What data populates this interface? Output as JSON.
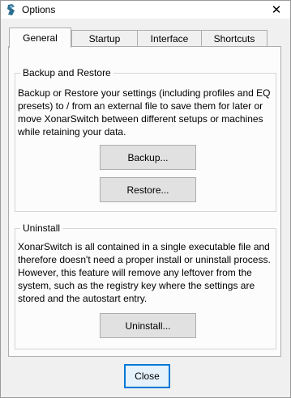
{
  "window": {
    "title": "Options",
    "close_glyph": "✕"
  },
  "tabs": [
    {
      "label": "General",
      "active": true
    },
    {
      "label": "Startup",
      "active": false
    },
    {
      "label": "Interface",
      "active": false
    },
    {
      "label": "Shortcuts",
      "active": false
    }
  ],
  "backup_group": {
    "legend": "Backup and Restore",
    "text": "Backup or Restore your settings (including profiles and EQ presets) to / from an external file to save them for later or move XonarSwitch between different setups or machines while retaining your data.",
    "backup_label": "Backup...",
    "restore_label": "Restore..."
  },
  "uninstall_group": {
    "legend": "Uninstall",
    "text": "XonarSwitch is all contained in a single executable file and therefore doesn't need a proper install or uninstall process. However, this feature will remove any leftover from the system, such as the registry key where the settings are stored and the autostart entry.",
    "uninstall_label": "Uninstall..."
  },
  "footer": {
    "close_label": "Close"
  },
  "colors": {
    "accent": "#0078d7",
    "panel_bg": "#fcfcfc",
    "window_bg": "#f0f0f0"
  }
}
